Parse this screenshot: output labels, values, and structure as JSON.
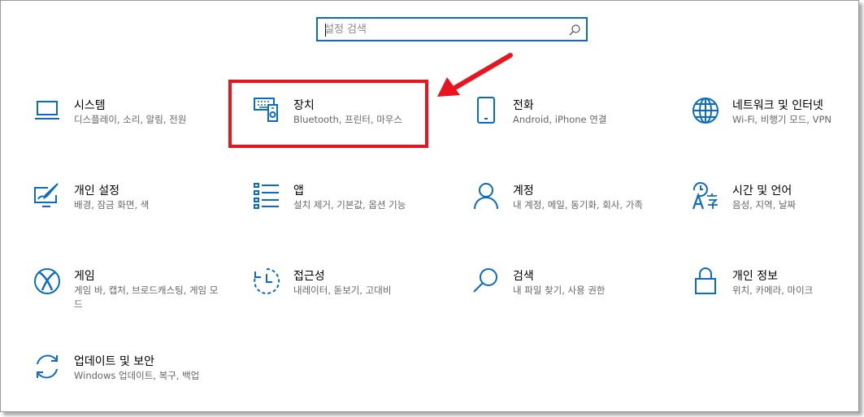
{
  "search": {
    "placeholder": "설정 검색",
    "icon": "search-icon"
  },
  "tiles": [
    {
      "title": "시스템",
      "desc": "디스플레이, 소리, 알림, 전원",
      "icon": "laptop-icon"
    },
    {
      "title": "장치",
      "desc": "Bluetooth, 프린터, 마우스",
      "icon": "devices-icon"
    },
    {
      "title": "전화",
      "desc": "Android, iPhone 연결",
      "icon": "phone-icon"
    },
    {
      "title": "네트워크 및 인터넷",
      "desc": "Wi-Fi, 비행기 모드, VPN",
      "icon": "globe-icon"
    },
    {
      "title": "개인 설정",
      "desc": "배경, 잠금 화면, 색",
      "icon": "personalization-icon"
    },
    {
      "title": "앱",
      "desc": "설치 제거, 기본값, 옵션 기능",
      "icon": "apps-list-icon"
    },
    {
      "title": "계정",
      "desc": "내 계정, 메일, 동기화, 회사, 가족",
      "icon": "person-icon"
    },
    {
      "title": "시간 및 언어",
      "desc": "음성, 지역, 날짜",
      "icon": "time-language-icon"
    },
    {
      "title": "게임",
      "desc": "게임 바, 캡처, 브로드캐스팅, 게임 모드",
      "icon": "xbox-icon"
    },
    {
      "title": "접근성",
      "desc": "내레이터, 돋보기, 고대비",
      "icon": "ease-of-access-icon"
    },
    {
      "title": "검색",
      "desc": "내 파일 찾기, 사용 권한",
      "icon": "magnifier-icon"
    },
    {
      "title": "개인 정보",
      "desc": "위치, 카메라, 마이크",
      "icon": "lock-icon"
    },
    {
      "title": "업데이트 및 보안",
      "desc": "Windows 업데이트, 복구, 백업",
      "icon": "sync-icon"
    }
  ],
  "colors": {
    "accent": "#0a6cc2",
    "highlight": "#e8141e",
    "description": "#666666"
  }
}
